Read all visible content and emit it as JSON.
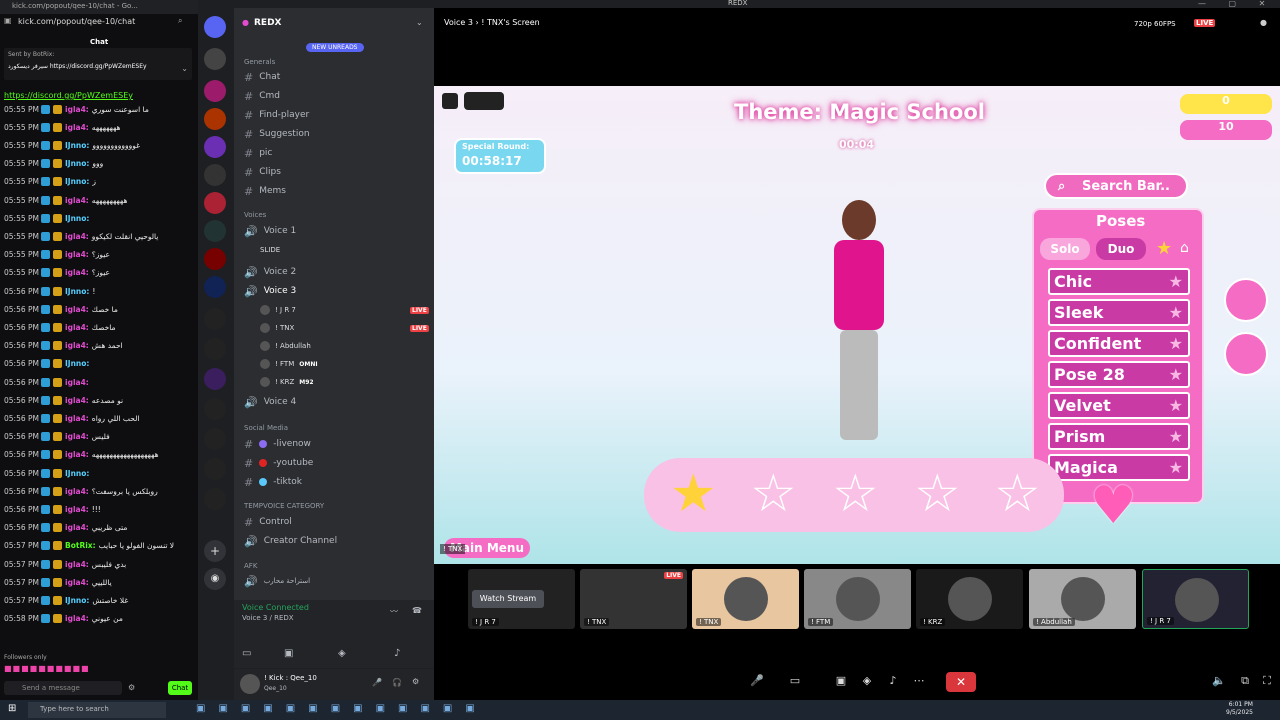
{
  "browser": {
    "url": "kick.com/popout/qee-10/chat",
    "tab_title": "kick.com/popout/qee-10/chat - Go..."
  },
  "chat": {
    "title": "Chat",
    "pinned": {
      "sender": "Sent by  BotRix:",
      "text": "سيرفر ديسكورد https://discord.gg/PpWZemESEy"
    },
    "link": "https://discord.gg/PpWZemESEy",
    "messages": [
      {
        "time": "05:55 PM",
        "user": "igla4:",
        "color": "#e34bd1",
        "text": "ما اسوعنت سوري"
      },
      {
        "time": "05:55 PM",
        "user": "igla4:",
        "color": "#e34bd1",
        "text": "هههههههه"
      },
      {
        "time": "05:55 PM",
        "user": "IJnno:",
        "color": "#55d0ff",
        "text": "غوووووووووووو"
      },
      {
        "time": "05:55 PM",
        "user": "IJnno:",
        "color": "#55d0ff",
        "text": "ووو"
      },
      {
        "time": "05:55 PM",
        "user": "IJnno:",
        "color": "#55d0ff",
        "text": "ز"
      },
      {
        "time": "05:55 PM",
        "user": "igla4:",
        "color": "#e34bd1",
        "text": "هههههههههه"
      },
      {
        "time": "05:55 PM",
        "user": "IJnno:",
        "color": "#55d0ff",
        "text": ""
      },
      {
        "time": "05:55 PM",
        "user": "igla4:",
        "color": "#e34bd1",
        "text": "يالوحيي انقلت لكيكوو"
      },
      {
        "time": "05:55 PM",
        "user": "igla4:",
        "color": "#e34bd1",
        "text": "عيوز؟"
      },
      {
        "time": "05:55 PM",
        "user": "igla4:",
        "color": "#e34bd1",
        "text": "عيوز؟"
      },
      {
        "time": "05:56 PM",
        "user": "IJnno:",
        "color": "#55d0ff",
        "text": "!"
      },
      {
        "time": "05:56 PM",
        "user": "igla4:",
        "color": "#e34bd1",
        "text": "ما خصك"
      },
      {
        "time": "05:56 PM",
        "user": "igla4:",
        "color": "#e34bd1",
        "text": "ماخصك"
      },
      {
        "time": "05:56 PM",
        "user": "igla4:",
        "color": "#e34bd1",
        "text": "احمد هش"
      },
      {
        "time": "05:56 PM",
        "user": "IJnno:",
        "color": "#55d0ff",
        "text": ""
      },
      {
        "time": "05:56 PM",
        "user": "igla4:",
        "color": "#e34bd1",
        "text": ""
      },
      {
        "time": "05:56 PM",
        "user": "igla4:",
        "color": "#e34bd1",
        "text": "نو مصدعه"
      },
      {
        "time": "05:56 PM",
        "user": "igla4:",
        "color": "#e34bd1",
        "text": "الحب اللي رواه"
      },
      {
        "time": "05:56 PM",
        "user": "igla4:",
        "color": "#e34bd1",
        "text": "فليس"
      },
      {
        "time": "05:56 PM",
        "user": "igla4:",
        "color": "#e34bd1",
        "text": "ههههههههههههههههههه"
      },
      {
        "time": "05:56 PM",
        "user": "IJnno:",
        "color": "#55d0ff",
        "text": ""
      },
      {
        "time": "05:56 PM",
        "user": "igla4:",
        "color": "#e34bd1",
        "text": "روبلكس يا بروسفت؟"
      },
      {
        "time": "05:56 PM",
        "user": "igla4:",
        "color": "#e34bd1",
        "text": "!!!"
      },
      {
        "time": "05:56 PM",
        "user": "igla4:",
        "color": "#e34bd1",
        "text": "متى ظريبي"
      },
      {
        "time": "05:57 PM",
        "user": "BotRix:",
        "color": "#53fc18",
        "text": "لا تنسون الفولو يا حبايب"
      },
      {
        "time": "05:57 PM",
        "user": "igla4:",
        "color": "#e34bd1",
        "text": "بدي فليبس"
      },
      {
        "time": "05:57 PM",
        "user": "igla4:",
        "color": "#e34bd1",
        "text": "ياللييي"
      },
      {
        "time": "05:57 PM",
        "user": "IJnno:",
        "color": "#55d0ff",
        "text": "غلا خاصتش"
      },
      {
        "time": "05:58 PM",
        "user": "igla4:",
        "color": "#e34bd1",
        "text": "من عيوني"
      }
    ],
    "followers_only": "Followers only",
    "send_placeholder": "Send a message",
    "chat_button": "Chat"
  },
  "server": {
    "name": "REDX",
    "new_unreads": "NEW UNREADS",
    "cat_general": "Generals",
    "text_channels": [
      {
        "name": "Chat"
      },
      {
        "name": "Cmd"
      },
      {
        "name": "Find-player"
      },
      {
        "name": "Suggestion"
      },
      {
        "name": "pic"
      },
      {
        "name": "Clips"
      },
      {
        "name": "Mems"
      }
    ],
    "cat_voices": "Voices",
    "voice1": "Voice 1",
    "voice1_user": "SLIDE",
    "voice2": "Voice 2",
    "voice3": "Voice 3",
    "voice3_users": [
      {
        "name": "! J R 7",
        "live": "LIVE"
      },
      {
        "name": "! TNX",
        "live": "LIVE"
      },
      {
        "name": "! Abdullah",
        "live": ""
      },
      {
        "name": "! FTM",
        "live": "OMNI"
      },
      {
        "name": "! KRZ",
        "live": "M92"
      }
    ],
    "voice4": "Voice 4",
    "cat_social": "Social Media",
    "social": [
      "-livenow",
      "-youtube",
      "-tiktok"
    ],
    "cat_temp": "TEMPVOICE CATEGORY",
    "control": "Control",
    "creator": "Creator Channel",
    "cat_afk": "AFK",
    "afk_channel": "استراحة محارب",
    "voice_connected": "Voice Connected",
    "voice_sub": "Voice 3 / REDX",
    "user_name": "! Kick : Qee_10",
    "user_tag": "Qee_10"
  },
  "stage": {
    "header": "Voice 3  ›  ! TNX's Screen",
    "quality": "720p 60FPS",
    "live": "LIVE"
  },
  "game": {
    "theme": "Theme: Magic School",
    "special_round": "Special Round:",
    "round_timer": "00:58:17",
    "timer": "00:04",
    "search": "Search Bar..",
    "poses_title": "Poses",
    "tab_solo": "Solo",
    "tab_duo": "Duo",
    "poses": [
      "Chic",
      "Sleek",
      "Confident",
      "Pose 28",
      "Velvet",
      "Prism",
      "Magica"
    ],
    "menu": "Main Menu",
    "counter1": "0",
    "counter2": "10",
    "tnx": "! TNX"
  },
  "tiles": [
    {
      "label": "! J R 7"
    },
    {
      "label": "! TNX",
      "live": "LIVE"
    },
    {
      "label": "! TNX"
    },
    {
      "label": "! FTM"
    },
    {
      "label": "! KRZ"
    },
    {
      "label": "! Abdullah"
    },
    {
      "label": "! J R 7"
    }
  ],
  "watch_stream": "Watch Stream",
  "taskbar": {
    "search": "Type here to search",
    "time": "6:01 PM",
    "date": "9/5/2025"
  }
}
